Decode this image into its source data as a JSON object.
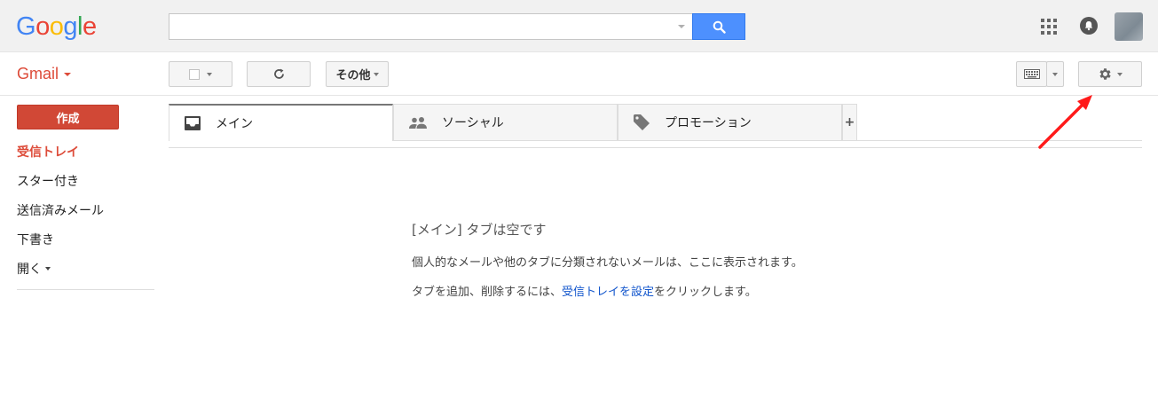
{
  "header": {
    "logo_letters": [
      {
        "char": "G",
        "color": "#4285F4"
      },
      {
        "char": "o",
        "color": "#EA4335"
      },
      {
        "char": "o",
        "color": "#FBBC05"
      },
      {
        "char": "g",
        "color": "#4285F4"
      },
      {
        "char": "l",
        "color": "#34A853"
      },
      {
        "char": "e",
        "color": "#EA4335"
      }
    ],
    "search": {
      "value": "",
      "placeholder": ""
    },
    "icons": {
      "search": "search-icon",
      "apps": "apps-grid-icon",
      "notifications": "notifications-bell-icon",
      "avatar": "account-avatar"
    }
  },
  "toolbar": {
    "app_title": "Gmail",
    "more_label": "その他",
    "icons": {
      "select": "select-checkbox-icon",
      "refresh": "refresh-icon",
      "keyboard": "keyboard-icon",
      "settings": "settings-gear-icon"
    }
  },
  "sidebar": {
    "compose_label": "作成",
    "items": [
      {
        "label": "受信トレイ",
        "active": true
      },
      {
        "label": "スター付き",
        "active": false
      },
      {
        "label": "送信済みメール",
        "active": false
      },
      {
        "label": "下書き",
        "active": false
      },
      {
        "label": "開く",
        "active": false
      }
    ]
  },
  "tabs": [
    {
      "label": "メイン",
      "icon": "inbox-tray-icon",
      "selected": true
    },
    {
      "label": "ソーシャル",
      "icon": "people-icon",
      "selected": false
    },
    {
      "label": "プロモーション",
      "icon": "tag-icon",
      "selected": false
    }
  ],
  "add_tab_label": "+",
  "empty_state": {
    "title": "[メイン] タブは空です",
    "description": "個人的なメールや他のタブに分類されないメールは、ここに表示されます。",
    "tip_before": "タブを追加、削除するには、",
    "tip_link": "受信トレイを設定",
    "tip_after": "をクリックします。"
  },
  "colors": {
    "accent_red": "#dd4b39",
    "compose_red": "#d14836",
    "search_blue": "#4d90fe",
    "link_blue": "#1155cc",
    "annotation_arrow": "#ff0000"
  }
}
